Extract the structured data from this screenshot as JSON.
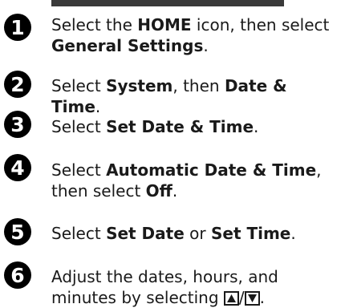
{
  "steps": [
    {
      "number": "1",
      "parts": [
        "Select the ",
        "HOME",
        " icon, then select ",
        "General Settings",
        "."
      ]
    },
    {
      "number": "2",
      "parts": [
        "Select ",
        "System",
        ", then ",
        "Date & Time",
        "."
      ]
    },
    {
      "number": "3",
      "parts": [
        "Select ",
        "Set Date & Time",
        "."
      ]
    },
    {
      "number": "4",
      "parts": [
        "Select ",
        "Automatic Date & Time",
        ", then select ",
        "Off",
        "."
      ]
    },
    {
      "number": "5",
      "parts": [
        "Select ",
        "Set Date",
        " or ",
        "Set Time",
        "."
      ]
    },
    {
      "number": "6",
      "parts": [
        "Adjust the dates, hours, and minutes by selecting ",
        "/",
        "."
      ]
    }
  ],
  "icons": {
    "up_arrow": "up-triangle-icon",
    "down_arrow": "down-triangle-icon"
  },
  "colors": {
    "badge": "#000000",
    "text": "#1a1a1a"
  }
}
